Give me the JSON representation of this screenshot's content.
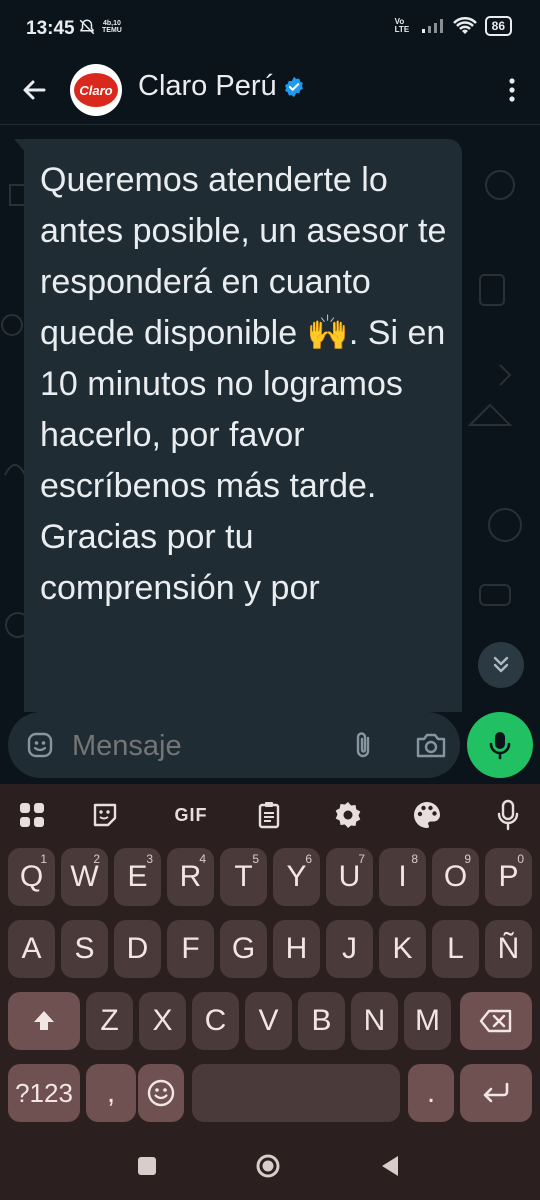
{
  "status_bar": {
    "time": "13:45",
    "left_badge_top": "4b,10",
    "left_badge_bottom": "TEMU",
    "network": "Vo LTE",
    "battery": "86"
  },
  "header": {
    "title": "Claro Perú",
    "avatar_text": "Claro",
    "verified": true
  },
  "message": {
    "text": "Queremos atenderte lo antes posible, un asesor te responderá en cuanto quede disponible 🙌. Si en 10 minutos no logramos hacerlo, por favor escríbenos más tarde.\nGracias por tu comprensión y por"
  },
  "input": {
    "placeholder": "Mensaje"
  },
  "keyboard": {
    "toolbar": [
      "apps-icon",
      "sticker-icon",
      "GIF",
      "clipboard-icon",
      "settings-icon",
      "palette-icon",
      "mic-icon"
    ],
    "row1": [
      {
        "label": "Q",
        "hint": "1"
      },
      {
        "label": "W",
        "hint": "2"
      },
      {
        "label": "E",
        "hint": "3"
      },
      {
        "label": "R",
        "hint": "4"
      },
      {
        "label": "T",
        "hint": "5"
      },
      {
        "label": "Y",
        "hint": "6"
      },
      {
        "label": "U",
        "hint": "7"
      },
      {
        "label": "I",
        "hint": "8"
      },
      {
        "label": "O",
        "hint": "9"
      },
      {
        "label": "P",
        "hint": "0"
      }
    ],
    "row2": [
      "A",
      "S",
      "D",
      "F",
      "G",
      "H",
      "J",
      "K",
      "L",
      "Ñ"
    ],
    "row3": [
      "Z",
      "X",
      "C",
      "V",
      "B",
      "N",
      "M"
    ],
    "symbols_label": "?123",
    "comma_label": ",",
    "period_label": "."
  },
  "colors": {
    "chat_bg": "#0b141a",
    "bubble": "#202c33",
    "mic_green": "#21c063",
    "keyboard_bg": "#2b1f1f",
    "key_bg": "#4a3a39",
    "key_special": "#6e5150"
  }
}
